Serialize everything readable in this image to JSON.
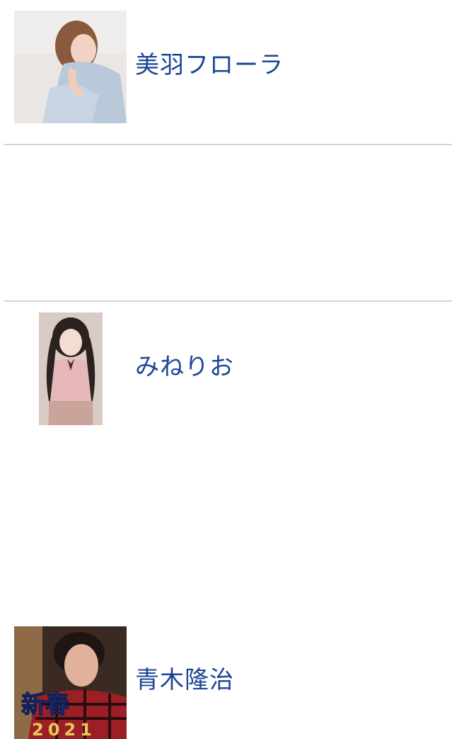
{
  "colors": {
    "link": "#1b4696",
    "divider": "#d4d4d4",
    "background": "#ffffff"
  },
  "list": {
    "items": [
      {
        "name": "美羽フローラ",
        "image": "person-photo"
      },
      {
        "name": "みねりお",
        "image": "person-photo"
      },
      {
        "name": "青木隆治",
        "image": "person-photo",
        "overlay_text": "新春",
        "overlay_year": "2021"
      }
    ]
  }
}
